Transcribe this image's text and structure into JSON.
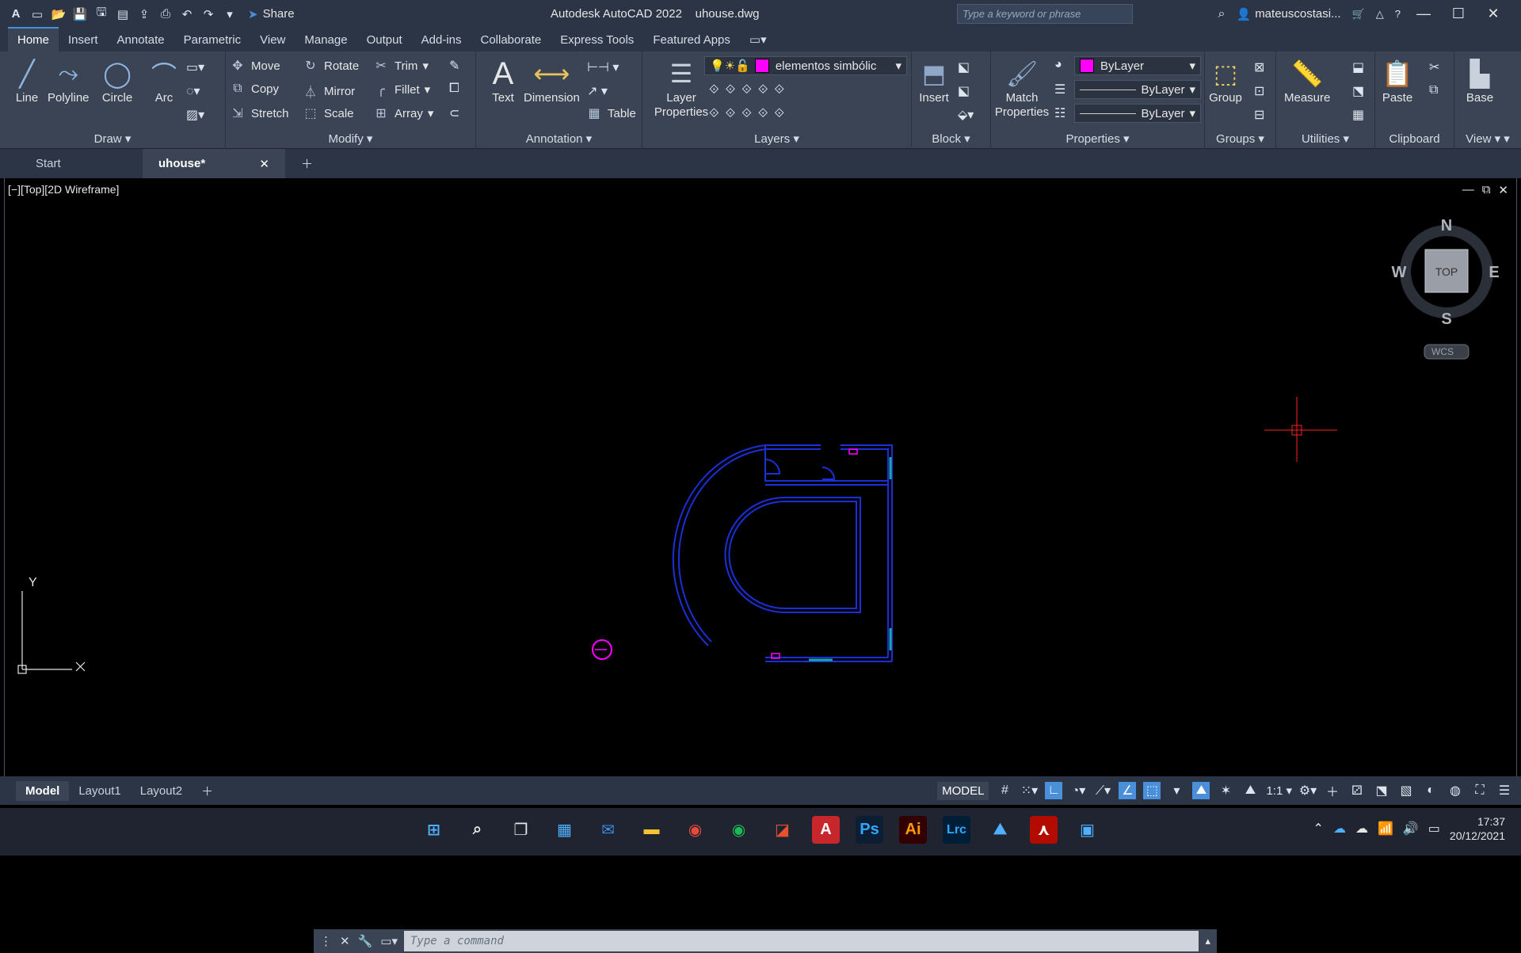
{
  "app": {
    "title": "Autodesk AutoCAD 2022",
    "filename": "uhouse.dwg",
    "share_label": "Share",
    "search_placeholder": "Type a keyword or phrase",
    "username": "mateuscostasi..."
  },
  "menu": {
    "tabs": [
      "Home",
      "Insert",
      "Annotate",
      "Parametric",
      "View",
      "Manage",
      "Output",
      "Add-ins",
      "Collaborate",
      "Express Tools",
      "Featured Apps"
    ]
  },
  "ribbon": {
    "draw": {
      "title": "Draw",
      "line": "Line",
      "polyline": "Polyline",
      "circle": "Circle",
      "arc": "Arc"
    },
    "modify": {
      "title": "Modify",
      "move": "Move",
      "rotate": "Rotate",
      "trim": "Trim",
      "copy": "Copy",
      "mirror": "Mirror",
      "fillet": "Fillet",
      "stretch": "Stretch",
      "scale": "Scale",
      "array": "Array"
    },
    "annotation": {
      "title": "Annotation",
      "text": "Text",
      "dimension": "Dimension",
      "table": "Table"
    },
    "layers": {
      "title": "Layers",
      "layer_properties": "Layer Properties",
      "current_layer": "elementos simbólic"
    },
    "block": {
      "title": "Block",
      "insert": "Insert"
    },
    "properties": {
      "title": "Properties",
      "match_properties": "Match Properties",
      "color": "ByLayer",
      "linetype": "ByLayer",
      "lineweight": "ByLayer"
    },
    "groups": {
      "title": "Groups",
      "group": "Group"
    },
    "utilities": {
      "title": "Utilities",
      "measure": "Measure"
    },
    "clipboard": {
      "title": "Clipboard",
      "paste": "Paste"
    },
    "view": {
      "title": "View",
      "base": "Base"
    }
  },
  "doc_tabs": {
    "start": "Start",
    "active": "uhouse*"
  },
  "viewport": {
    "label": "[−][Top][2D Wireframe]",
    "viewcube": {
      "n": "N",
      "s": "S",
      "e": "E",
      "w": "W",
      "face": "TOP",
      "wcs": "WCS"
    },
    "ucs": {
      "y": "Y"
    }
  },
  "command": {
    "placeholder": "Type a command"
  },
  "layouts": {
    "model": "Model",
    "layout1": "Layout1",
    "layout2": "Layout2"
  },
  "statusbar": {
    "model": "MODEL",
    "scale": "1:1"
  },
  "taskbar": {
    "time": "17:37",
    "date": "20/12/2021",
    "ps": "Ps",
    "ai": "Ai",
    "lrc": "Lrc"
  },
  "colors": {
    "accent": "#4a8fd9",
    "layer_magenta": "#ff00ff",
    "wall_blue": "#1a2fd6",
    "cursor_red": "#ff0000"
  }
}
